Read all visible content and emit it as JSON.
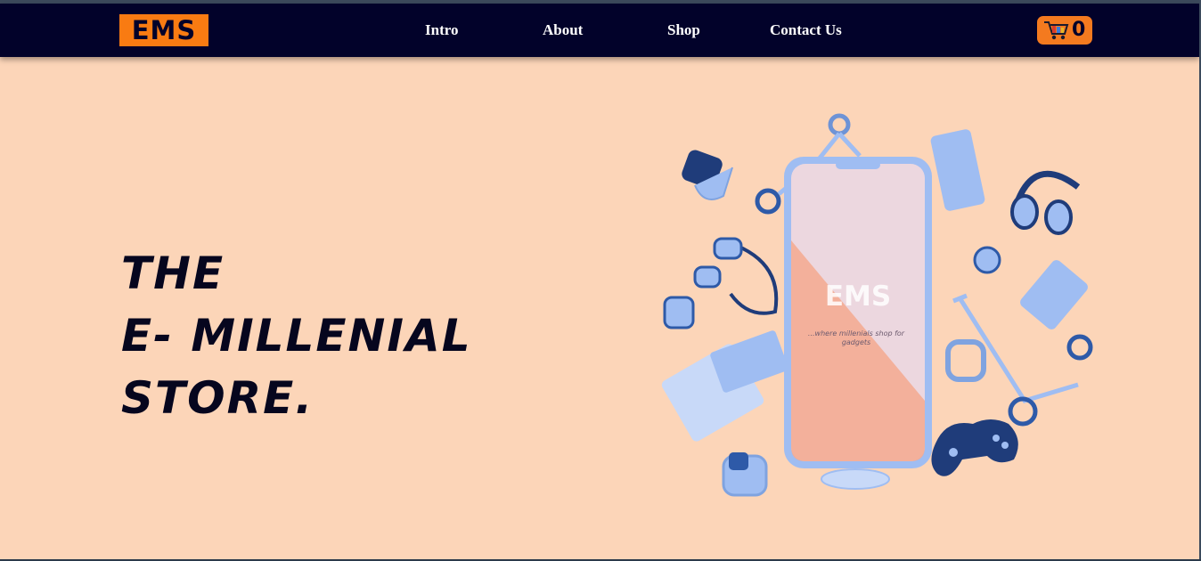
{
  "nav": {
    "logo": "EMS",
    "links": [
      "Intro",
      "About",
      "Shop",
      "Contact Us"
    ],
    "cart_count": "0"
  },
  "hero": {
    "title_lines": [
      "THE",
      "E- MILLENIAL",
      "STORE."
    ],
    "phone_logo": "EMS",
    "phone_tagline": "...where millenials shop for gadgets"
  },
  "colors": {
    "background": "#fcd5b8",
    "navbar": "#02022a",
    "accent": "#f97b12",
    "gadgets": "#9fbdf2"
  }
}
